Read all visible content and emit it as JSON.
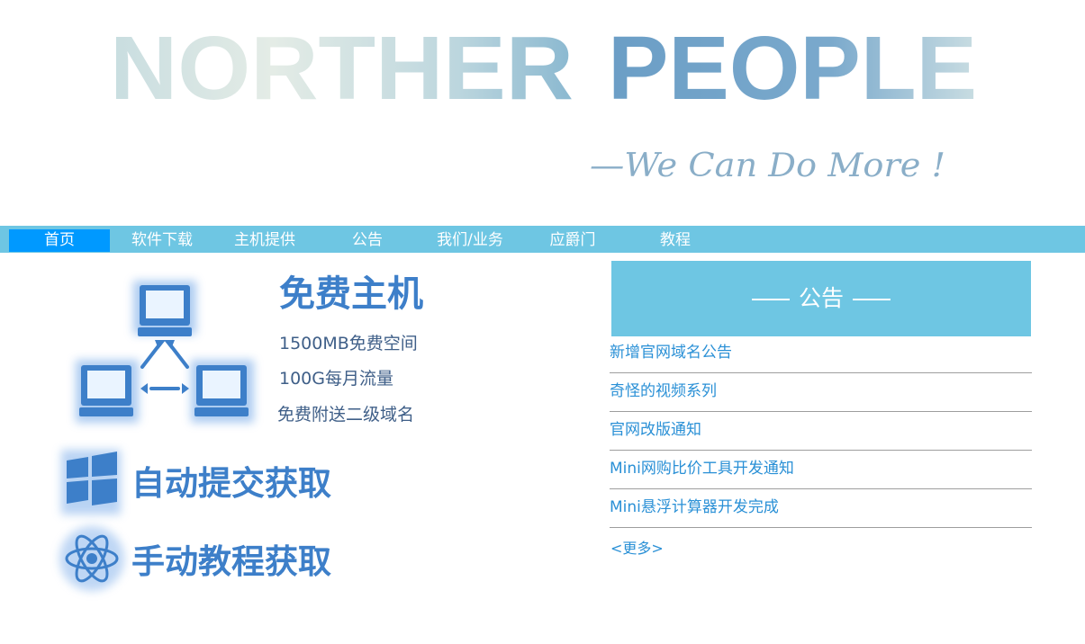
{
  "banner": {
    "title_left": "NORTHER",
    "title_right": "PEOPLE",
    "slogan": "—We Can Do More !"
  },
  "nav": {
    "items": [
      {
        "label": "首页",
        "active": true
      },
      {
        "label": "软件下载",
        "active": false
      },
      {
        "label": "主机提供",
        "active": false
      },
      {
        "label": "公告",
        "active": false
      },
      {
        "label": "我们/业务",
        "active": false
      },
      {
        "label": "应爵门",
        "active": false
      },
      {
        "label": "教程",
        "active": false
      }
    ]
  },
  "promo": {
    "host_title": "免费主机",
    "host_features": [
      "1500MB免费空间",
      "100G每月流量",
      "免费附送二级域名"
    ],
    "auto_label": "自动提交获取",
    "manual_label": "手动教程获取"
  },
  "notice": {
    "title": "公告",
    "items": [
      "新增官网域名公告",
      "奇怪的视频系列",
      "官网改版通知",
      "Mini网购比价工具开发通知",
      "Mini悬浮计算器开发完成"
    ],
    "more": "<更多>"
  },
  "colors": {
    "nav_bg": "#6ec6e3",
    "nav_active": "#0099ff",
    "link": "#2a90d6",
    "promo_blue": "#3d7fc9"
  },
  "icons": [
    "computer-network-icon",
    "windows-logo-icon",
    "atom-icon"
  ]
}
